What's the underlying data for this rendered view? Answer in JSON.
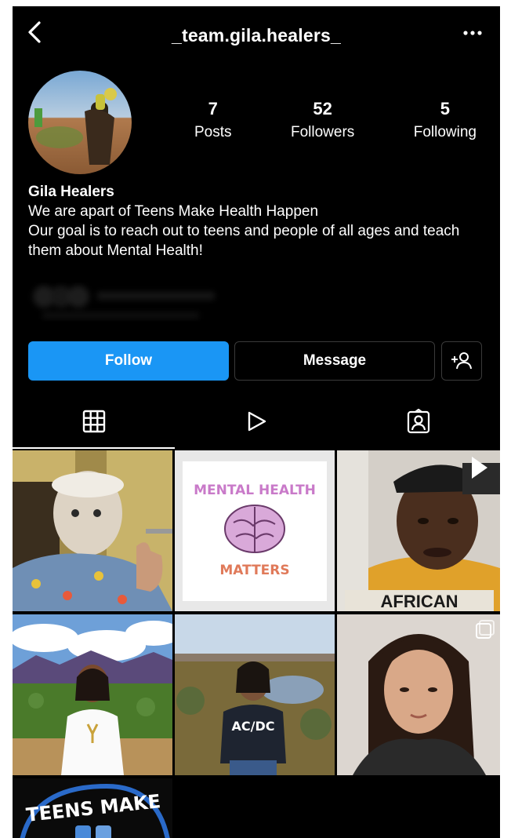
{
  "header": {
    "handle": "_team.gila.healers_",
    "back_icon": "chevron-left-icon",
    "more_icon": "more-horizontal-icon"
  },
  "stats": [
    {
      "value": "7",
      "label": "Posts"
    },
    {
      "value": "52",
      "label": "Followers"
    },
    {
      "value": "5",
      "label": "Following"
    }
  ],
  "bio": {
    "name": "Gila Healers",
    "lines": [
      "We are apart of Teens Make Health Happen",
      "Our goal is to reach out to teens and people of all ages and teach them about Mental Health!"
    ]
  },
  "actions": {
    "follow_label": "Follow",
    "message_label": "Message",
    "add_user_icon": "add-user-icon"
  },
  "tabs": [
    {
      "name": "grid-icon",
      "active": true
    },
    {
      "name": "reels-icon",
      "active": false
    },
    {
      "name": "tagged-icon",
      "active": false
    }
  ],
  "posts": {
    "mental_health_text_top": "MENTAL HEALTH",
    "mental_health_text_bottom": "MATTERS",
    "shirt_text": "AFRICAN",
    "band_shirt_text": "AC/DC",
    "teens_text": "TEENS MAKE"
  },
  "colors": {
    "accent": "#1a96f5",
    "background": "#000000",
    "border": "#3a3a3a"
  }
}
